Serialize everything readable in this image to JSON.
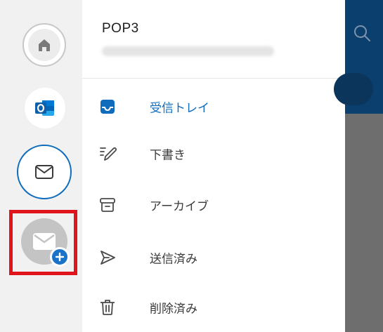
{
  "account": {
    "name": "POP3"
  },
  "folders": [
    {
      "label": "受信トレイ",
      "icon": "inbox-icon",
      "active": true
    },
    {
      "label": "下書き",
      "icon": "pen-icon",
      "active": false
    },
    {
      "label": "アーカイブ",
      "icon": "archive-icon",
      "active": false
    },
    {
      "label": "送信済み",
      "icon": "send-icon",
      "active": false
    },
    {
      "label": "削除済み",
      "icon": "trash-icon",
      "active": false
    }
  ],
  "rail": {
    "accounts": [
      "home-icon",
      "outlook-icon",
      "mail-icon",
      "add-account-icon"
    ]
  },
  "colors": {
    "accent": "#0f6cbd",
    "highlight": "#e0141b",
    "header": "#0a3f6e"
  }
}
